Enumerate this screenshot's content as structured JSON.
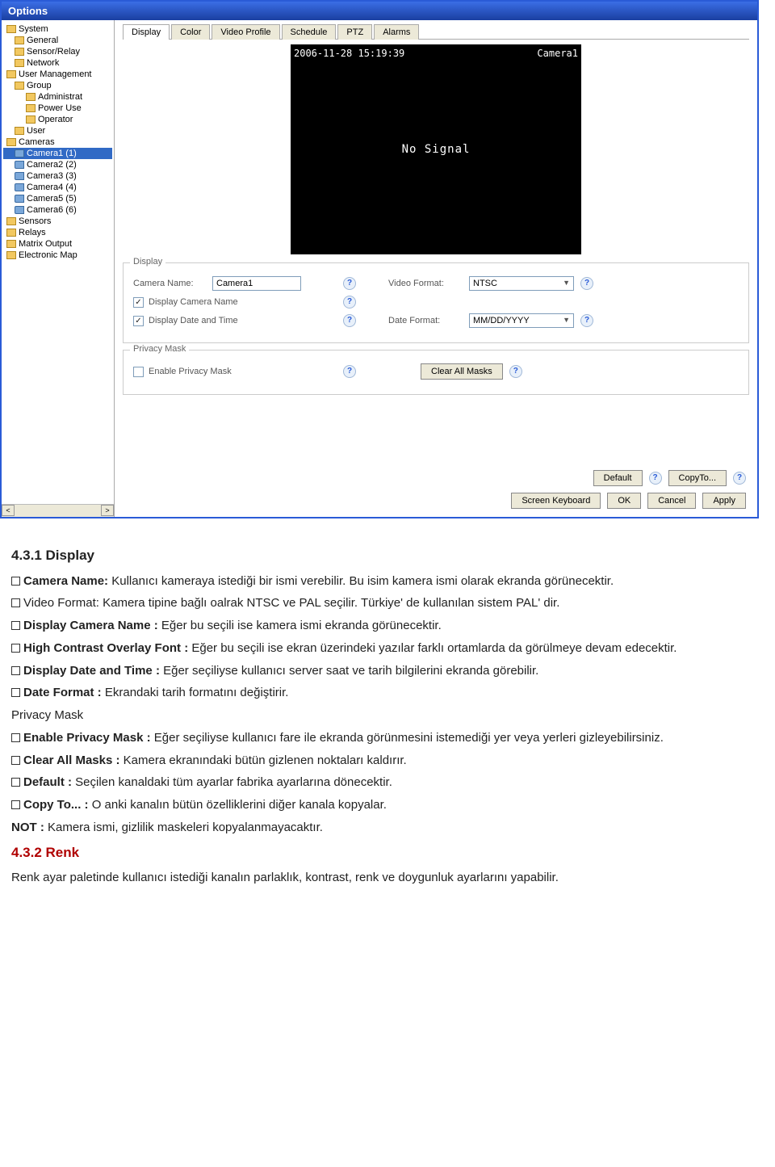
{
  "window": {
    "title": "Options"
  },
  "tree": {
    "items": [
      {
        "label": "System",
        "level": 0,
        "type": "folder"
      },
      {
        "label": "General",
        "level": 1,
        "type": "folder"
      },
      {
        "label": "Sensor/Relay",
        "level": 1,
        "type": "folder"
      },
      {
        "label": "Network",
        "level": 1,
        "type": "folder"
      },
      {
        "label": "User Management",
        "level": 0,
        "type": "folder"
      },
      {
        "label": "Group",
        "level": 1,
        "type": "folder"
      },
      {
        "label": "Administrat",
        "level": 2,
        "type": "folder"
      },
      {
        "label": "Power Use",
        "level": 2,
        "type": "folder"
      },
      {
        "label": "Operator",
        "level": 2,
        "type": "folder"
      },
      {
        "label": "User",
        "level": 1,
        "type": "folder"
      },
      {
        "label": "Cameras",
        "level": 0,
        "type": "folder"
      },
      {
        "label": "Camera1 (1)",
        "level": 1,
        "type": "cam",
        "selected": true
      },
      {
        "label": "Camera2 (2)",
        "level": 1,
        "type": "cam"
      },
      {
        "label": "Camera3 (3)",
        "level": 1,
        "type": "cam"
      },
      {
        "label": "Camera4 (4)",
        "level": 1,
        "type": "cam"
      },
      {
        "label": "Camera5 (5)",
        "level": 1,
        "type": "cam"
      },
      {
        "label": "Camera6 (6)",
        "level": 1,
        "type": "cam"
      },
      {
        "label": "Sensors",
        "level": 0,
        "type": "folder"
      },
      {
        "label": "Relays",
        "level": 0,
        "type": "folder"
      },
      {
        "label": "Matrix Output",
        "level": 0,
        "type": "folder"
      },
      {
        "label": "Electronic Map",
        "level": 0,
        "type": "folder"
      }
    ]
  },
  "tabs": [
    "Display",
    "Color",
    "Video Profile",
    "Schedule",
    "PTZ",
    "Alarms"
  ],
  "preview": {
    "timestamp": "2006-11-28 15:19:39",
    "camera_label": "Camera1",
    "center_text": "No Signal"
  },
  "display_group": {
    "legend": "Display",
    "camera_name_label": "Camera Name:",
    "camera_name_value": "Camera1",
    "video_format_label": "Video Format:",
    "video_format_value": "NTSC",
    "display_camera_name_label": "Display Camera Name",
    "display_date_time_label": "Display Date and Time",
    "date_format_label": "Date Format:",
    "date_format_value": "MM/DD/YYYY"
  },
  "privacy_group": {
    "legend": "Privacy Mask",
    "enable_label": "Enable Privacy Mask",
    "clear_button": "Clear All Masks"
  },
  "footer": {
    "default": "Default",
    "copy_to": "CopyTo...",
    "screen_keyboard": "Screen Keyboard",
    "ok": "OK",
    "cancel": "Cancel",
    "apply": "Apply"
  },
  "doc": {
    "h1": "4.3.1 Display",
    "camera_name_t": "Camera Name:",
    "camera_name_b": " Kullanıcı kameraya istediği bir ismi verebilir. Bu isim kamera ismi olarak ekranda görünecektir.",
    "video_format_t": "Video Format:",
    "video_format_b": " Kamera tipine bağlı oalrak NTSC ve PAL seçilir. Türkiye' de kullanılan sistem PAL' dir.",
    "disp_cam_t": "Display Camera Name :",
    "disp_cam_b": " Eğer bu seçili ise kamera ismi ekranda görünecektir.",
    "hc_font_t": "High Contrast Overlay Font :",
    "hc_font_b": " Eğer bu seçili ise ekran üzerindeki yazılar farklı ortamlarda da görülmeye devam edecektir.",
    "disp_dt_t": "Display Date and Time :",
    "disp_dt_b": " Eğer seçiliyse kullanıcı server saat ve tarih bilgilerini ekranda görebilir.",
    "date_fmt_t": "Date Format :",
    "date_fmt_b": " Ekrandaki tarih formatını değiştirir.",
    "privacy_heading": "Privacy Mask",
    "enable_pm_t": "Enable Privacy Mask :",
    "enable_pm_b": " Eğer seçiliyse kullanıcı fare ile ekranda görünmesini istemediği yer veya yerleri gizleyebilirsiniz.",
    "clear_t": "Clear All Masks :",
    "clear_b": " Kamera ekranındaki bütün gizlenen noktaları kaldırır.",
    "default_t": "Default :",
    "default_b": " Seçilen kanaldaki tüm ayarlar fabrika ayarlarına dönecektir.",
    "copy_t": "Copy To... :",
    "copy_b": "  O anki kanalın bütün özelliklerini diğer kanala kopyalar.",
    "not_t": "NOT :",
    "not_b": " Kamera ismi, gizlilik maskeleri kopyalanmayacaktır.",
    "h2": "4.3.2 Renk",
    "renk_b": "Renk ayar paletinde kullanıcı istediği kanalın parlaklık, kontrast, renk ve doygunluk ayarlarını yapabilir."
  }
}
